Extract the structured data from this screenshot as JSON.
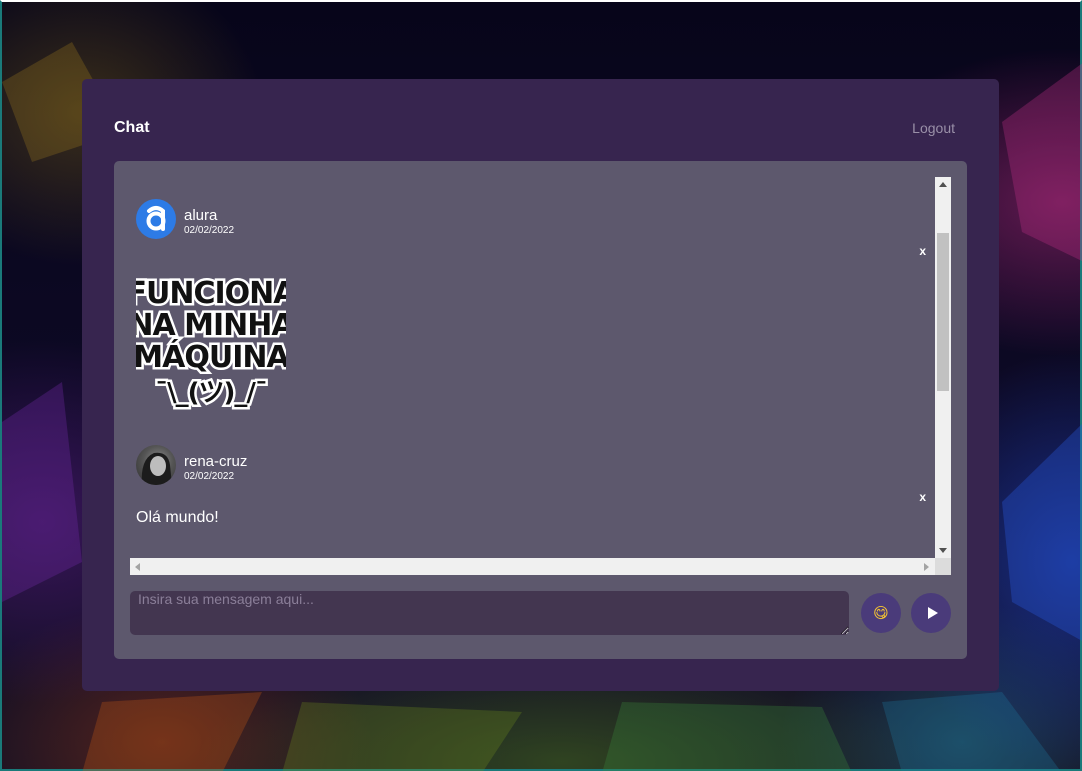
{
  "header": {
    "title": "Chat",
    "logout_label": "Logout"
  },
  "messages": [
    {
      "user": "alura",
      "date": "02/02/2022",
      "delete_label": "x",
      "sticker_lines": [
        "FUNCIONA",
        "NA MINHA",
        "MÁQUINA",
        "¯\\_(ツ)_/¯"
      ]
    },
    {
      "user": "rena-cruz",
      "date": "02/02/2022",
      "delete_label": "x",
      "text": "Olá mundo!"
    }
  ],
  "composer": {
    "placeholder": "Insira sua mensagem aqui...",
    "value": ""
  },
  "icons": {
    "emoji_button": "smiley-icon",
    "send_button": "play-icon"
  },
  "colors": {
    "container": "#37254f",
    "panel": "#5d586d",
    "input": "#433650",
    "buttons": "#4a3b7a"
  }
}
